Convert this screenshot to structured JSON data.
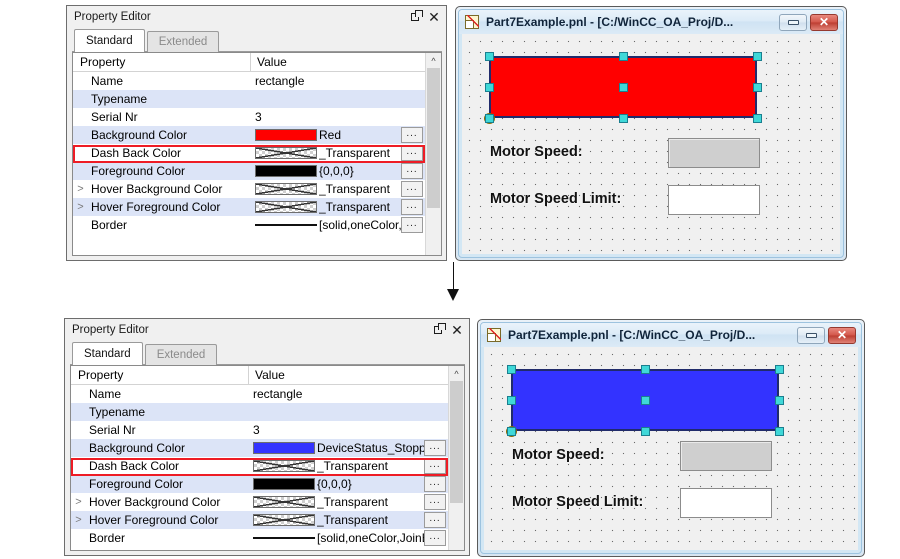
{
  "panels": {
    "property_editor": {
      "title": "Property Editor",
      "float_icon": "restore-icon",
      "close_icon": "close-icon",
      "tabs": [
        {
          "label": "Standard",
          "active": true
        },
        {
          "label": "Extended",
          "active": false
        }
      ],
      "columns": [
        "Property",
        "Value"
      ],
      "ellipsis_button_label": "...",
      "expander_glyph": ">",
      "scroll_up_glyph": "^"
    },
    "top_rows": [
      {
        "name": "Name",
        "value": "rectangle",
        "swatch": "none",
        "expander": false,
        "button": false
      },
      {
        "name": "Typename",
        "value": "",
        "swatch": "none",
        "expander": false,
        "button": false
      },
      {
        "name": "Serial Nr",
        "value": "3",
        "swatch": "none",
        "expander": false,
        "button": false
      },
      {
        "name": "Background Color",
        "value": "Red",
        "swatch": "solid",
        "swatch_color": "#ff0000",
        "expander": false,
        "button": true,
        "highlight": true
      },
      {
        "name": "Dash Back Color",
        "value": "_Transparent",
        "swatch": "transparent",
        "expander": false,
        "button": true
      },
      {
        "name": "Foreground Color",
        "value": "{0,0,0}",
        "swatch": "solid",
        "swatch_color": "#000000",
        "expander": false,
        "button": true
      },
      {
        "name": "Hover Background Color",
        "value": "_Transparent",
        "swatch": "transparent",
        "expander": true,
        "button": true
      },
      {
        "name": "Hover Foreground Color",
        "value": "_Transparent",
        "swatch": "transparent",
        "expander": true,
        "button": true
      },
      {
        "name": "Border",
        "value": "[solid,oneColor,Jo",
        "swatch": "line",
        "expander": false,
        "button": true
      }
    ],
    "bottom_rows": [
      {
        "name": "Name",
        "value": "rectangle",
        "swatch": "none",
        "expander": false,
        "button": false
      },
      {
        "name": "Typename",
        "value": "",
        "swatch": "none",
        "expander": false,
        "button": false
      },
      {
        "name": "Serial Nr",
        "value": "3",
        "swatch": "none",
        "expander": false,
        "button": false
      },
      {
        "name": "Background Color",
        "value": "DeviceStatus_Stopped",
        "swatch": "solid",
        "swatch_color": "#3333ff",
        "expander": false,
        "button": true,
        "highlight": true
      },
      {
        "name": "Dash Back Color",
        "value": "_Transparent",
        "swatch": "transparent",
        "expander": false,
        "button": true
      },
      {
        "name": "Foreground Color",
        "value": "{0,0,0}",
        "swatch": "solid",
        "swatch_color": "#000000",
        "expander": false,
        "button": true
      },
      {
        "name": "Hover Background Color",
        "value": "_Transparent",
        "swatch": "transparent",
        "expander": true,
        "button": true
      },
      {
        "name": "Hover Foreground Color",
        "value": "_Transparent",
        "swatch": "transparent",
        "expander": true,
        "button": true
      },
      {
        "name": "Border",
        "value": "[solid,oneColor,JoinBeve",
        "swatch": "line",
        "expander": false,
        "button": true
      }
    ]
  },
  "pnl_window": {
    "title": "Part7Example.pnl - [C:/WinCC_OA_Proj/D...",
    "app_icon": "panel-editor-icon",
    "minimize_icon": "minimize-icon",
    "close_icon": "close-icon",
    "labels": {
      "motor_speed": "Motor Speed:",
      "motor_speed_limit": "Motor Speed Limit:"
    },
    "fields": {
      "motor_speed_value": "",
      "motor_speed_limit_value": ""
    },
    "top_shape_color": "#ff0000",
    "bottom_shape_color": "#3333ff"
  },
  "arrow": {
    "name": "flow-arrow-down"
  },
  "colors": {
    "highlight": "#ee1c25",
    "row_alt": "#dce4f7",
    "selection_handle": "#3fd8d8"
  }
}
